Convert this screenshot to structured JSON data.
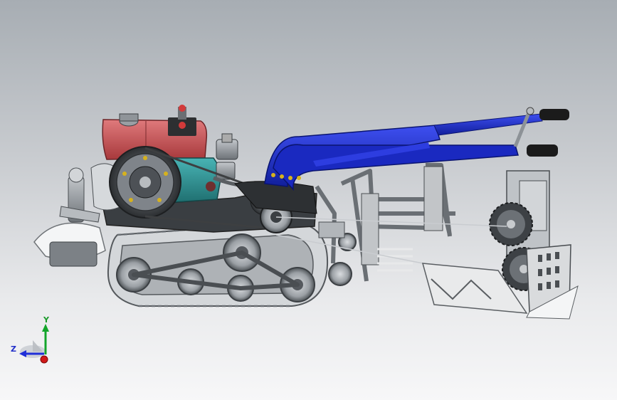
{
  "triad": {
    "axis_y_label": "Y",
    "axis_z_label": "Z",
    "colors": {
      "x": "#d01818",
      "y": "#12a52a",
      "z": "#1f2fd8"
    }
  },
  "model": {
    "parts": [
      "engine",
      "fuel-tank",
      "flywheel",
      "crawler-track",
      "handlebar-frame",
      "cutter-disc",
      "gear-drive",
      "collection-basket",
      "belt-drive"
    ],
    "colors": {
      "engine_body": "#c8585a",
      "pump_housing": "#2f9a9a",
      "handlebar": "#1e2fd0",
      "steel": "#8e949a",
      "track": "#cfd2d5",
      "grip": "#1b1b1b"
    }
  }
}
